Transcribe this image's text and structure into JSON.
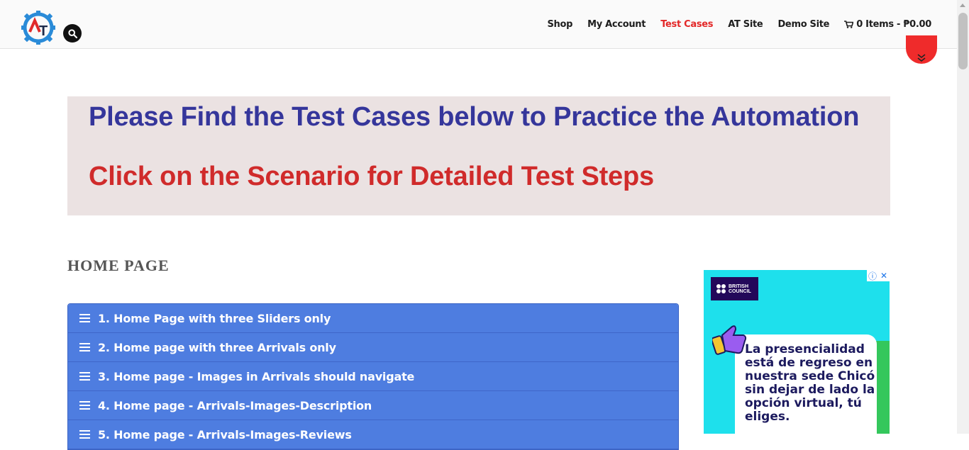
{
  "header": {
    "logo_text": "AT",
    "nav": [
      {
        "label": "Shop"
      },
      {
        "label": "My Account"
      },
      {
        "label": "Test Cases",
        "active": true
      },
      {
        "label": "AT Site"
      },
      {
        "label": "Demo Site"
      }
    ],
    "cart_label": "0 Items - ₱0.00"
  },
  "banner": {
    "heading": "Please Find the Test Cases below to Practice the Automation",
    "subheading": "Click on the Scenario for Detailed Test Steps"
  },
  "section": {
    "title": "HOME PAGE",
    "items": [
      {
        "label": "1. Home Page with three Sliders only"
      },
      {
        "label": "2. Home page with three Arrivals only"
      },
      {
        "label": "3. Home page - Images in Arrivals should navigate"
      },
      {
        "label": "4. Home page - Arrivals-Images-Description"
      },
      {
        "label": "5. Home page - Arrivals-Images-Reviews"
      }
    ]
  },
  "ad": {
    "brand": "BRITISH COUNCIL",
    "text": "La presencialidad está de regreso en nuestra sede Chicó sin dejar de lado la opción virtual, tú eliges."
  },
  "colors": {
    "heading_blue": "#35369b",
    "heading_red": "#d02b2b",
    "accordion_blue": "#4e7de0",
    "nav_active": "#e32727"
  }
}
